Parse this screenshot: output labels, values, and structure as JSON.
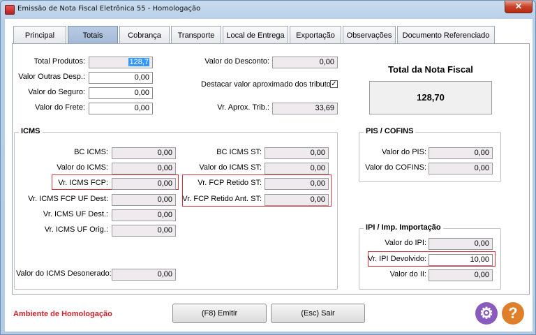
{
  "window": {
    "title": "Emissão de Nota Fiscal Eletrônica 55 - Homologação",
    "close_label": "✕"
  },
  "tabs": [
    {
      "label": "Principal",
      "active": false
    },
    {
      "label": "Totais",
      "active": true
    },
    {
      "label": "Cobrança",
      "active": false
    },
    {
      "label": "Transporte",
      "active": false
    },
    {
      "label": "Local de Entrega",
      "active": false
    },
    {
      "label": "Exportação",
      "active": false
    },
    {
      "label": "Observações",
      "active": false
    },
    {
      "label": "Documento Referenciado",
      "active": false
    }
  ],
  "totals": {
    "total_produtos": {
      "label": "Total Produtos:",
      "value": "128,7"
    },
    "valor_outras_desp": {
      "label": "Valor Outras Desp.:",
      "value": "0,00"
    },
    "valor_seguro": {
      "label": "Valor do Seguro:",
      "value": "0,00"
    },
    "valor_frete": {
      "label": "Valor do Frete:",
      "value": "0,00"
    },
    "valor_desconto": {
      "label": "Valor do Desconto:",
      "value": "0,00"
    },
    "destacar": {
      "label": "Destacar valor aproximado dos tributos",
      "checked": true,
      "check_glyph": "✓"
    },
    "vr_aprox_trib": {
      "label": "Vr. Aprox. Trib.:",
      "value": "33,69"
    },
    "total_nota": {
      "label": "Total da Nota Fiscal",
      "value": "128,70"
    }
  },
  "icms": {
    "title": "ICMS",
    "bc_icms": {
      "label": "BC ICMS:",
      "value": "0,00"
    },
    "valor_icms": {
      "label": "Valor do ICMS:",
      "value": "0,00"
    },
    "vr_icms_fcp": {
      "label": "Vr. ICMS FCP:",
      "value": "0,00"
    },
    "vr_icms_fcp_uf_dest": {
      "label": "Vr. ICMS FCP UF Dest:",
      "value": "0,00"
    },
    "vr_icms_uf_dest": {
      "label": "Vr. ICMS UF Dest.:",
      "value": "0,00"
    },
    "vr_icms_uf_orig": {
      "label": "Vr. ICMS UF Orig.:",
      "value": "0,00"
    },
    "bc_icms_st": {
      "label": "BC ICMS ST:",
      "value": "0,00"
    },
    "valor_icms_st": {
      "label": "Valor do ICMS ST:",
      "value": "0,00"
    },
    "vr_fcp_retido_st": {
      "label": "Vr. FCP Retido ST:",
      "value": "0,00"
    },
    "vr_fcp_retido_ant_st": {
      "label": "Vr. FCP Retido Ant. ST:",
      "value": "0,00"
    },
    "valor_icms_desonerado": {
      "label": "Valor do ICMS Desonerado:",
      "value": "0,00"
    }
  },
  "pis_cofins": {
    "title": "PIS / COFINS",
    "valor_pis": {
      "label": "Valor do PIS:",
      "value": "0,00"
    },
    "valor_cofins": {
      "label": "Valor do COFINS:",
      "value": "0,00"
    }
  },
  "ipi": {
    "title": "IPI / Imp. Importação",
    "valor_ipi": {
      "label": "Valor do IPI:",
      "value": "0,00"
    },
    "vr_ipi_devolvido": {
      "label": "Vr. IPI Devolvido:",
      "value": "10,00"
    },
    "valor_ii": {
      "label": "Valor do II:",
      "value": "0,00"
    }
  },
  "footer": {
    "environment": "Ambiente de Homologação",
    "emitir_label": "(F8) Emitir",
    "sair_label": "(Esc) Sair",
    "settings_icon": "gear-icon",
    "help_icon": "help-icon",
    "help_glyph": "?",
    "settings_glyph": "⚙"
  },
  "colors": {
    "highlight": "#d4323f",
    "environment_text": "#d0202a",
    "settings_icon": "#8a5bbf",
    "help_icon": "#e07f2a"
  }
}
